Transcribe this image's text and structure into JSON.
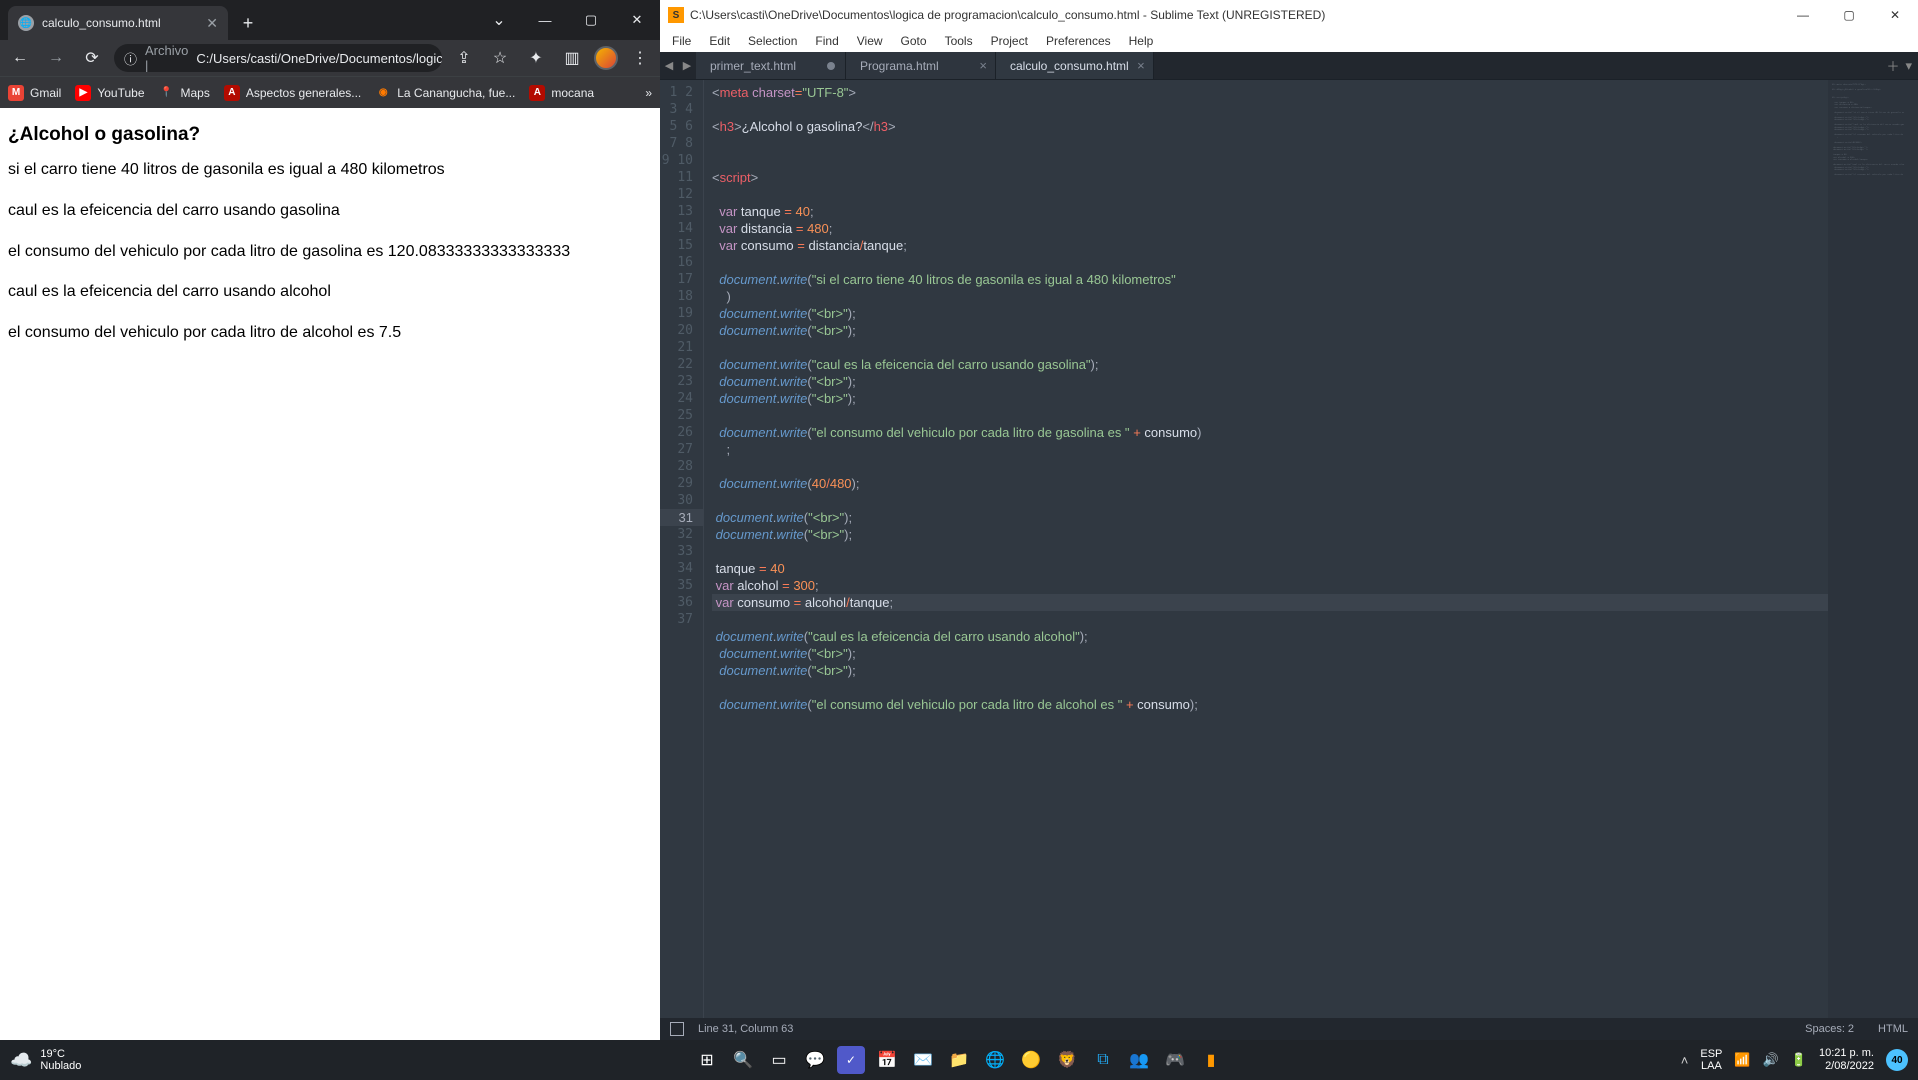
{
  "chrome": {
    "tab_title": "calculo_consumo.html",
    "omnibox_prefix": "Archivo |",
    "omnibox_path": "C:/Users/casti/OneDrive/Documentos/logic...",
    "bookmarks": [
      {
        "label": "Gmail",
        "icon": "M",
        "bg": "#ea4335",
        "fg": "#fff"
      },
      {
        "label": "YouTube",
        "icon": "▶",
        "bg": "#ff0000",
        "fg": "#fff"
      },
      {
        "label": "Maps",
        "icon": "📍",
        "bg": "transparent",
        "fg": ""
      },
      {
        "label": "Aspectos generales...",
        "icon": "A",
        "bg": "#b30b00",
        "fg": "#fff"
      },
      {
        "label": "La Canangucha, fue...",
        "icon": "◉",
        "bg": "#ff7a00",
        "fg": "#fff"
      },
      {
        "label": "mocana",
        "icon": "A",
        "bg": "#b30b00",
        "fg": "#fff"
      }
    ],
    "bookmarks_more": "»",
    "page": {
      "heading": "¿Alcohol o gasolina?",
      "p1": "si el carro tiene 40 litros de gasonila es igual a 480 kilometros",
      "p2": "caul es la efeicencia del carro usando gasolina",
      "p3": "el consumo del vehiculo por cada litro de gasolina es 120.08333333333333333",
      "p4": "caul es la efeicencia del carro usando alcohol",
      "p5": "el consumo del vehiculo por cada litro de alcohol es 7.5"
    }
  },
  "sublime": {
    "title": "C:\\Users\\casti\\OneDrive\\Documentos\\logica de programacion\\calculo_consumo.html - Sublime Text (UNREGISTERED)",
    "menu": [
      "File",
      "Edit",
      "Selection",
      "Find",
      "View",
      "Goto",
      "Tools",
      "Project",
      "Preferences",
      "Help"
    ],
    "tabs": [
      {
        "label": "primer_text.html",
        "dirty": true,
        "active": false
      },
      {
        "label": "Programa.html",
        "dirty": false,
        "active": false
      },
      {
        "label": "calculo_consumo.html",
        "dirty": false,
        "active": true
      }
    ],
    "gutter_lines": 37,
    "highlighted_line": 31,
    "status_left": "Line 31, Column 63",
    "status_spaces": "Spaces: 2",
    "status_syntax": "HTML"
  },
  "taskbar": {
    "temp": "19°C",
    "weather": "Nublado",
    "lang1": "ESP",
    "lang2": "LAA",
    "time": "10:21 p. m.",
    "date": "2/08/2022",
    "notif_count": "40"
  }
}
